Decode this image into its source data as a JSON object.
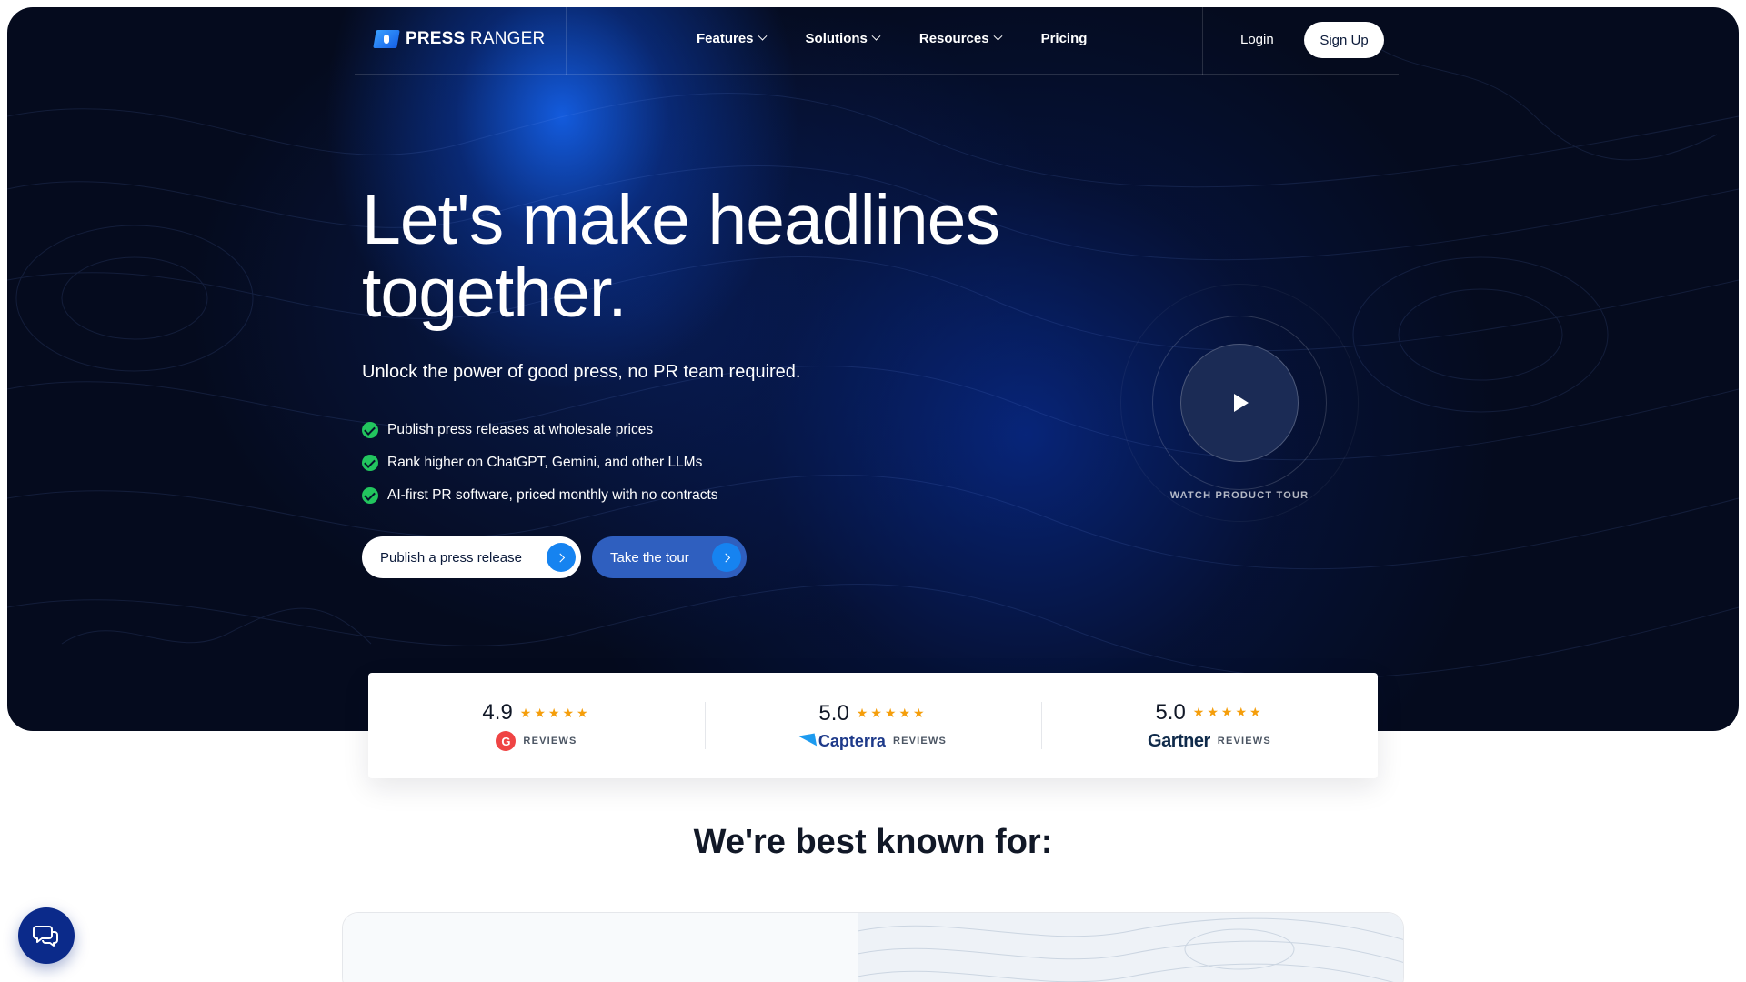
{
  "brand": {
    "name_bold": "PRESS",
    "name_rest": " RANGER"
  },
  "nav": {
    "links": [
      {
        "label": "Features",
        "dropdown": true
      },
      {
        "label": "Solutions",
        "dropdown": true
      },
      {
        "label": "Resources",
        "dropdown": true
      },
      {
        "label": "Pricing",
        "dropdown": false
      }
    ],
    "login": "Login",
    "signup": "Sign Up"
  },
  "hero": {
    "headline_line1": "Let's make headlines",
    "headline_line2": "together.",
    "subhead": "Unlock the power of good press, no PR team required.",
    "bullets": [
      "Publish press releases at wholesale prices",
      "Rank higher on ChatGPT, Gemini, and other LLMs",
      "AI-first PR software, priced monthly with no contracts"
    ],
    "primary_cta": "Publish a press release",
    "secondary_cta": "Take the tour",
    "video_label": "WATCH PRODUCT TOUR"
  },
  "ratings": [
    {
      "score": "4.9",
      "stars": 5,
      "source": "G2",
      "logo_text": "G",
      "reviews": "REVIEWS"
    },
    {
      "score": "5.0",
      "stars": 5,
      "source": "Capterra",
      "logo_text": "Capterra",
      "reviews": "REVIEWS"
    },
    {
      "score": "5.0",
      "stars": 5,
      "source": "Gartner",
      "logo_text": "Gartner",
      "reviews": "REVIEWS"
    }
  ],
  "section": {
    "title": "We're best known for:"
  },
  "colors": {
    "hero_bg": "#050b1e",
    "accent_blue": "#1683f0",
    "secondary_btn": "#2f5fbf",
    "check_green": "#22c55e",
    "star": "#f59e0b",
    "chat": "#0b2a8a"
  },
  "icons": {
    "chevron": "chevron-down-icon",
    "check": "check-circle-icon",
    "arrow": "chevron-right-icon",
    "play": "play-icon",
    "chat": "chat-bubbles-icon"
  }
}
